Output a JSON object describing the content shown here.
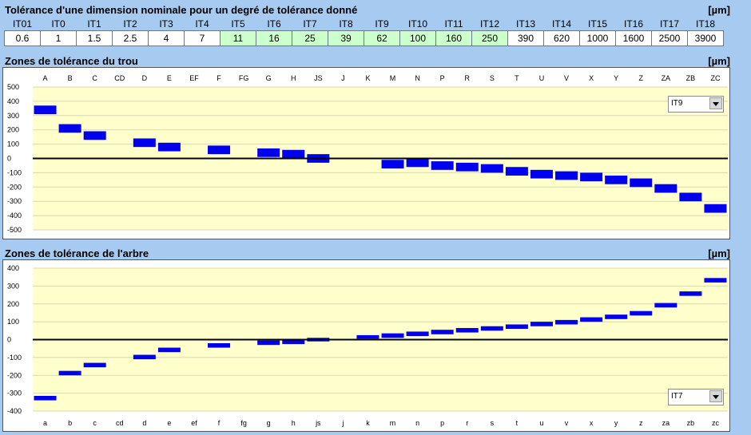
{
  "header": {
    "title": "Tolérance d'une dimension nominale pour un degré de tolérance donné",
    "unit": "[µm]"
  },
  "it_table": {
    "grades": [
      "IT01",
      "IT0",
      "IT1",
      "IT2",
      "IT3",
      "IT4",
      "IT5",
      "IT6",
      "IT7",
      "IT8",
      "IT9",
      "IT10",
      "IT11",
      "IT12",
      "IT13",
      "IT14",
      "IT15",
      "IT16",
      "IT17",
      "IT18"
    ],
    "values": [
      "0.6",
      "1",
      "1.5",
      "2.5",
      "4",
      "7",
      "11",
      "16",
      "25",
      "39",
      "62",
      "100",
      "160",
      "250",
      "390",
      "620",
      "1000",
      "1600",
      "2500",
      "3900"
    ],
    "highlight_color": "#ccffcc",
    "highlighted": [
      6,
      7,
      8,
      9,
      10,
      11,
      12,
      13
    ]
  },
  "hole_panel": {
    "title": "Zones de tolérance du trou",
    "unit": "[µm]",
    "selector": {
      "value": "IT9"
    }
  },
  "shaft_panel": {
    "title": "Zones de tolérance de l'arbre",
    "unit": "[µm]",
    "selector": {
      "value": "IT7"
    }
  },
  "chart_data": [
    {
      "type": "bar",
      "categories": [
        "A",
        "B",
        "C",
        "CD",
        "D",
        "E",
        "EF",
        "F",
        "FG",
        "G",
        "H",
        "JS",
        "J",
        "K",
        "M",
        "N",
        "P",
        "R",
        "S",
        "T",
        "U",
        "V",
        "X",
        "Y",
        "Z",
        "ZA",
        "ZB",
        "ZC"
      ],
      "ranges": [
        [
          310,
          370
        ],
        [
          180,
          240
        ],
        [
          130,
          190
        ],
        [
          -2,
          2
        ],
        [
          80,
          140
        ],
        [
          50,
          110
        ],
        [
          -2,
          2
        ],
        [
          30,
          90
        ],
        [
          -2,
          2
        ],
        [
          10,
          70
        ],
        [
          0,
          60
        ],
        [
          -30,
          30
        ],
        [
          -2,
          2
        ],
        [
          -2,
          2
        ],
        [
          -70,
          -10
        ],
        [
          -60,
          0
        ],
        [
          -80,
          -20
        ],
        [
          -90,
          -30
        ],
        [
          -100,
          -40
        ],
        [
          -120,
          -60
        ],
        [
          -140,
          -80
        ],
        [
          -150,
          -90
        ],
        [
          -160,
          -100
        ],
        [
          -180,
          -120
        ],
        [
          -200,
          -140
        ],
        [
          -240,
          -180
        ],
        [
          -300,
          -240
        ],
        [
          -380,
          -320
        ]
      ],
      "ylim": [
        -500,
        500
      ],
      "yticks": [
        500,
        400,
        300,
        200,
        100,
        0,
        -100,
        -200,
        -300,
        -400,
        -500
      ],
      "bar_color": "#0000ee",
      "grid": true
    },
    {
      "type": "bar",
      "categories": [
        "a",
        "b",
        "c",
        "cd",
        "d",
        "e",
        "ef",
        "f",
        "fg",
        "g",
        "h",
        "js",
        "j",
        "k",
        "m",
        "n",
        "p",
        "r",
        "s",
        "t",
        "u",
        "v",
        "x",
        "y",
        "z",
        "za",
        "zb",
        "zc"
      ],
      "ranges": [
        [
          -340,
          -315
        ],
        [
          -200,
          -175
        ],
        [
          -155,
          -130
        ],
        [
          -2,
          2
        ],
        [
          -110,
          -85
        ],
        [
          -70,
          -45
        ],
        [
          -2,
          2
        ],
        [
          -45,
          -20
        ],
        [
          -2,
          2
        ],
        [
          -30,
          -5
        ],
        [
          -25,
          0
        ],
        [
          -10,
          10
        ],
        [
          -2,
          2
        ],
        [
          5,
          25
        ],
        [
          10,
          35
        ],
        [
          20,
          45
        ],
        [
          30,
          55
        ],
        [
          40,
          65
        ],
        [
          50,
          75
        ],
        [
          60,
          85
        ],
        [
          75,
          100
        ],
        [
          85,
          110
        ],
        [
          100,
          125
        ],
        [
          115,
          140
        ],
        [
          135,
          160
        ],
        [
          180,
          205
        ],
        [
          245,
          270
        ],
        [
          320,
          345
        ]
      ],
      "ylim": [
        -400,
        400
      ],
      "yticks": [
        400,
        300,
        200,
        100,
        0,
        -100,
        -200,
        -300,
        -400
      ],
      "bar_color": "#0000ee",
      "grid": true
    }
  ]
}
